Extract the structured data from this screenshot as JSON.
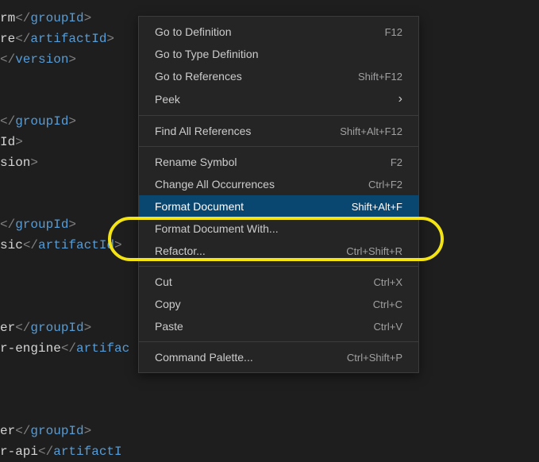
{
  "editor": {
    "lines": [
      {
        "prefix": "rm",
        "close_tag": "groupId"
      },
      {
        "prefix": "re",
        "close_tag": "artifactId"
      },
      {
        "prefix": "",
        "close_tag": "version",
        "leading": true
      },
      {
        "blank": true
      },
      {
        "blank": true
      },
      {
        "prefix": "",
        "close_tag": "groupId",
        "leading": true
      },
      {
        "prefix": "Id",
        "open_close": true
      },
      {
        "prefix": "sion",
        "open_close": true
      },
      {
        "blank": true
      },
      {
        "blank": true
      },
      {
        "prefix": "",
        "close_tag": "groupId",
        "leading": true
      },
      {
        "prefix": "sic",
        "close_tag": "artifactId",
        "trailing_open": true
      },
      {
        "blank": true
      },
      {
        "blank": true
      },
      {
        "blank": true
      },
      {
        "prefix": "er",
        "close_tag": "groupId"
      },
      {
        "prefix": "r-engine",
        "close_tag": "artifac",
        "cut": true
      },
      {
        "blank": true
      },
      {
        "blank": true
      },
      {
        "blank": true
      },
      {
        "prefix": "er",
        "close_tag": "groupId"
      },
      {
        "prefix": "r-api",
        "close_tag": "artifactI",
        "cut": true
      }
    ]
  },
  "menu": {
    "groups": [
      [
        {
          "label": "Go to Definition",
          "shortcut": "F12"
        },
        {
          "label": "Go to Type Definition",
          "shortcut": ""
        },
        {
          "label": "Go to References",
          "shortcut": "Shift+F12"
        },
        {
          "label": "Peek",
          "submenu": true
        }
      ],
      [
        {
          "label": "Find All References",
          "shortcut": "Shift+Alt+F12"
        }
      ],
      [
        {
          "label": "Rename Symbol",
          "shortcut": "F2"
        },
        {
          "label": "Change All Occurrences",
          "shortcut": "Ctrl+F2"
        },
        {
          "label": "Format Document",
          "shortcut": "Shift+Alt+F",
          "highlighted": true
        },
        {
          "label": "Format Document With...",
          "shortcut": ""
        },
        {
          "label": "Refactor...",
          "shortcut": "Ctrl+Shift+R"
        }
      ],
      [
        {
          "label": "Cut",
          "shortcut": "Ctrl+X"
        },
        {
          "label": "Copy",
          "shortcut": "Ctrl+C"
        },
        {
          "label": "Paste",
          "shortcut": "Ctrl+V"
        }
      ],
      [
        {
          "label": "Command Palette...",
          "shortcut": "Ctrl+Shift+P"
        }
      ]
    ]
  }
}
